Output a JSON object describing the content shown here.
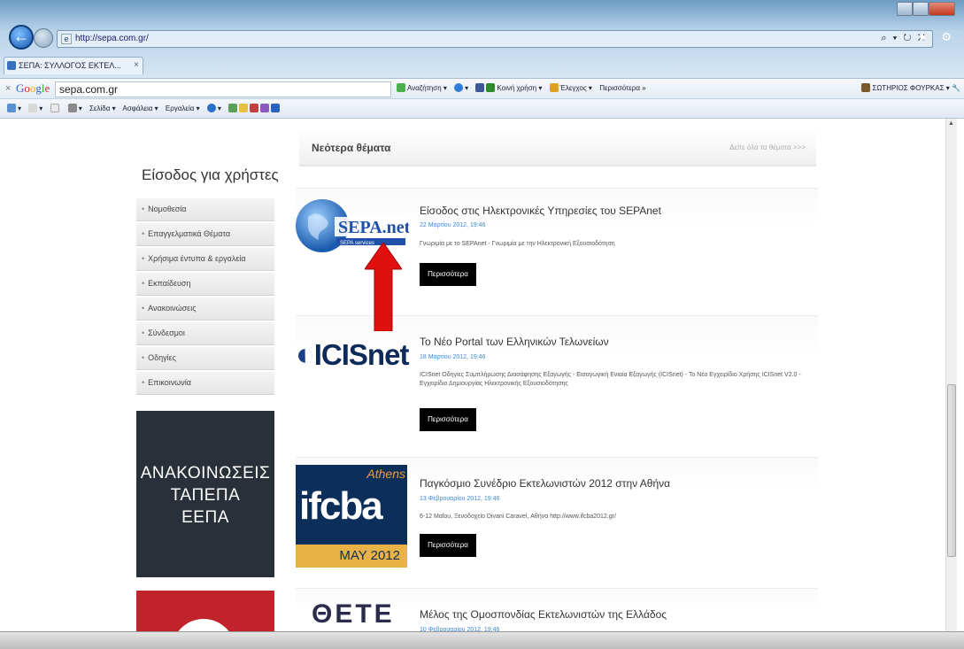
{
  "browser": {
    "url": "http://sepa.com.gr/",
    "address_controls": "⌕ ▾ ↻ ✕",
    "nav_icons": "⌂ ★ ⚙",
    "tab_label": "ΣΕΠΑ: ΣΥΛΛΟΓΟΣ ΕΚΤΕΛ...",
    "tab_close": "×"
  },
  "google_toolbar": {
    "search_value": "sepa.com.gr",
    "items": [
      "Αναζήτηση ▾",
      "Κοινή χρήση ▾",
      "Έλεγχος ▾",
      "Περισσότερα »"
    ],
    "user_name": "ΣΩΤΗΡΙΟΣ ΦΟΥΡΚΑΣ ▾"
  },
  "command_bar": {
    "items": [
      "Σελίδα ▾",
      "Ασφάλεια ▾",
      "Εργαλεία ▾"
    ]
  },
  "sidebar": {
    "login_title": "Είσοδος για χρήστες",
    "menu": [
      "Νομοθεσία",
      "Επαγγελματικά Θέματα",
      "Χρήσιμα έντυπα & εργαλεία",
      "Εκπαίδευση",
      "Ανακοινώσεις",
      "Σύνδεσμοι",
      "Οδηγίες",
      "Επικοινωνία"
    ],
    "banner_lines": [
      "ΑΝΑΚΟΙΝΩΣΕΙΣ",
      "ΤΑΠΕΠΑ",
      "ΕΕΠΑ"
    ]
  },
  "news": {
    "header_title": "Νεότερα θέματα",
    "see_all": "Δείτε όλα τα θέματα >>>",
    "more_label": "Περισσότερα",
    "items": [
      {
        "title": "Είσοδος στις Ηλεκτρονικές Υπηρεσίες του SEPAnet",
        "date": "22 Μαρτίου 2012, 19:46",
        "desc": "Γνωριμία με το SEPAnet - Γνωριμία με την Ηλεκτρονική Εξουσιοδότηση"
      },
      {
        "title": "Το Νέο Portal των Ελληνικών Τελωνείων",
        "date": "18 Μαρτίου 2012, 19:46",
        "desc": "ICISnet Οδηγίες Συμπλήρωσης Διασάφησης Εξαγωγής - Εισαγωγική Ενιαία Εξαγωγής (ICISnet) - Το Νέο Εγχειρίδιο Χρήσης ICISnet V2.0 - Εγχειρίδιο Δημιουργίας Ηλεκτρονικής Εξουσιοδότησης"
      },
      {
        "title": "Παγκόσμιο Συνέδριο Εκτελωνιστών 2012 στην Αθήνα",
        "date": "13 Φεβρουαρίου 2012, 19:46",
        "desc": "6-12 Μαΐου, Ξενοδοχείο Divani Caravel, Αθήνα http://www.ifcba2012.gr/"
      },
      {
        "title": "Μέλος της Ομοσπονδίας Εκτελωνιστών της Ελλάδος",
        "date": "10 Φεβρουαρίου 2012, 19:46",
        "desc": ""
      }
    ],
    "logos": {
      "sepa_main": "SEPA.net",
      "sepa_sub": "SEPA services",
      "icis": "ICISnet",
      "ifcba_word": "ifcba",
      "ifcba_city": "Athens",
      "ifcba_date": "MAY 2012",
      "oete": "ΘΕΤΕ"
    }
  },
  "colors": {
    "arrow": "#e01010",
    "date_link": "#3a86d6",
    "banner_bg": "#2a3039"
  }
}
